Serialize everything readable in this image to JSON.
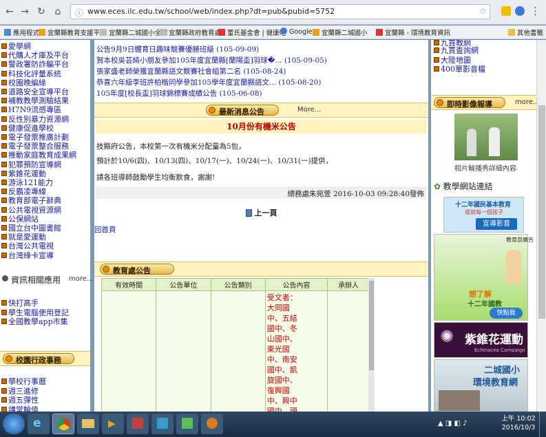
{
  "browser": {
    "url": "www.eces.ilc.edu.tw/school/web/index.php?dt=pub&pubid=5752",
    "tabs": [
      "宜蘭縣二城國小全球資訊網"
    ],
    "bookmarks": [
      "應用程式",
      "宜蘭縣教育支援平台",
      "宜蘭縣二城國小全球",
      "宜蘭縣政府教育處",
      "董氏基金會 | 健康吃",
      "Google",
      "宜蘭縣二城國小",
      "宜蘭縣 - 環境教育資訊"
    ],
    "other_bookmarks": "其他書籤"
  },
  "left": {
    "links_top": [
      "愛學網",
      "代購人才庫及平台",
      "警政署防詐騙平台",
      "科技化評量系統",
      "校園晚編緣",
      "道路安全宣導平台",
      "補教教學測驗結果",
      "H7N9流感專區",
      "反性別暴力資源網",
      "健康促進學校",
      "電子發票推廣計劃",
      "電子發票整合服務",
      "推動家庭教育成果網",
      "犯罪預防宣導網",
      "紫錐花運動",
      "游泳121能力",
      "反霸凌專線",
      "教育部電子辭典",
      "公共電視資源網",
      "公保網站",
      "國立台中圖書館",
      "就是愛運動",
      "台灣公共電視",
      "台灣綠卡宣導"
    ],
    "info_apps_title": "資訊相關應用",
    "info_apps_more": "more...",
    "info_apps": [
      "快打高手",
      "學生電腦使用登記",
      "全國教學app市集"
    ],
    "admin_title": "校園行政事務",
    "admin_links": [
      "學校行事曆",
      "週三進修",
      "週五彈性",
      "講堂輪值"
    ]
  },
  "main": {
    "news_top": [
      "公告9月9日體育日趣味競賽優勝班級 (105-09-09)",
      "賀本校吳芸綺小朋友參加105年度宜蘭縣[蘭陽盃]羽球�... (105-09-05)",
      "張家盛老師榮獲宜蘭縣語文競賽社會組第二名 (105-08-24)",
      "恭喜六年級李班許柏楷同學參加105學年度宜蘭縣語文... (105-08-20)",
      "105年度[校長盃]羽球錦標賽成績公告 (105-06-08)"
    ],
    "latest_title": "最新消息公告",
    "latest_more": "More...",
    "article_title": "10月份有機米公告",
    "article_p1": "技縣府公告，本校第一次有機米分配量為5包，",
    "article_p2": "預計於10/6(四)、10/13(四)、10/17(一)、10/24(一)、10/31(一)提供，",
    "article_p3": "請各班導師鼓勵學生均衡飲食，謝謝!",
    "article_meta": "總務處朱宛萱  2016-10-03 09:28:40發佈",
    "prev_page": "上一頁",
    "home": "回首頁",
    "edu_title": "教育處公告",
    "edu_table": {
      "headers": [
        "有效時間",
        "公告單位",
        "公告類別",
        "公告內容",
        "承辦人"
      ],
      "content_lines": [
        "受文者：",
        "大同國",
        "中、五結",
        "國中、冬",
        "山國中、",
        "東光國",
        "中、南安",
        "國中、凱",
        "旋國中、",
        "復興國",
        "中、興中",
        "國中、頭"
      ]
    }
  },
  "right": {
    "top_links": [
      "九貫查詢網",
      "大陸地圖",
      "400單影音檔"
    ],
    "top_partial": "九貫教網",
    "photo_title": "即時影像報導",
    "photo_more": "more...",
    "photo_caption": "相片輪播秀詳細內容",
    "links_title": "教學網站連結",
    "banner1_line1": "十二年國民基本教育",
    "banner1_line2": "成就每一個孩子",
    "banner1_line3": "宣導影音",
    "banner2_tag": "教育部廣告",
    "banner2_line1": "想了解",
    "banner2_line2": "十二年國教",
    "banner2_line3": "快點我",
    "banner3": "紫錐花運動",
    "banner3_sub": "Echinacea Campaign",
    "banner4_line1": "二城國小",
    "banner4_line2": "環境教育網"
  },
  "taskbar": {
    "time": "上午 10:02",
    "date": "2016/10/3"
  }
}
